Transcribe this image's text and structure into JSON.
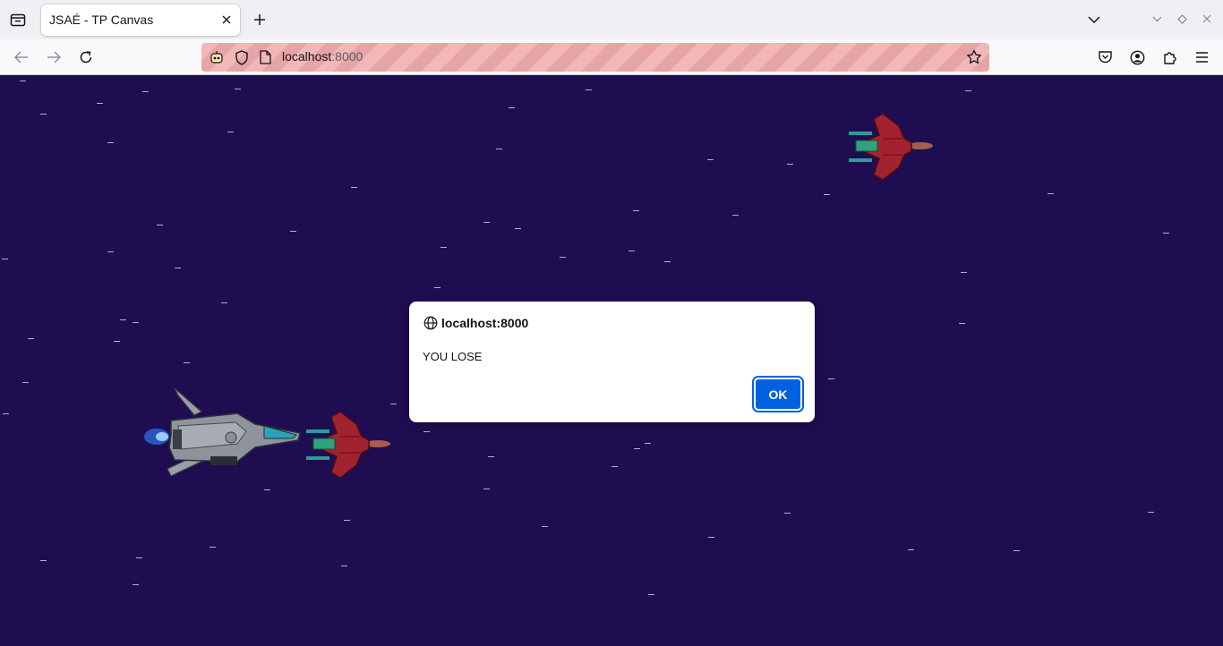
{
  "browser": {
    "tab_title": "JSAÉ - TP Canvas",
    "url_host": "localhost",
    "url_port": ":8000"
  },
  "dialog": {
    "origin": "localhost:8000",
    "message": "YOU LOSE",
    "ok_label": "OK"
  },
  "colors": {
    "background": "#1f0d52",
    "accent": "#0061e0",
    "enemy": "#a2232f"
  },
  "icons": [
    "firefox-view-icon",
    "close-icon",
    "new-tab-icon",
    "list-tabs-icon",
    "back-icon",
    "forward-icon",
    "reload-icon",
    "robot-icon",
    "shield-icon",
    "page-icon",
    "star-icon",
    "pocket-icon",
    "account-icon",
    "extensions-icon",
    "menu-icon",
    "globe-icon"
  ]
}
